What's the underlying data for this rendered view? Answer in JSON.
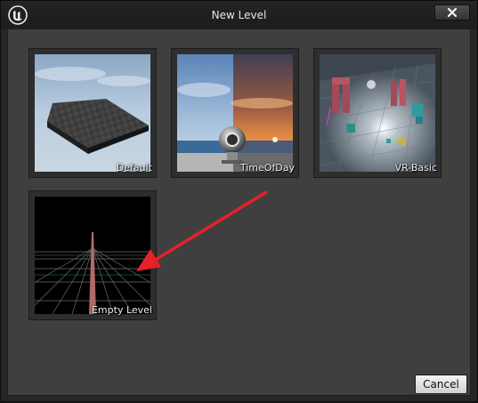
{
  "window": {
    "title": "New Level",
    "close_icon": "close-icon",
    "logo_icon": "unreal-engine-logo"
  },
  "templates": [
    {
      "label": "Default"
    },
    {
      "label": "TimeOfDay"
    },
    {
      "label": "VR-Basic"
    },
    {
      "label": "Empty Level"
    }
  ],
  "footer": {
    "cancel_label": "Cancel"
  },
  "annotation": {
    "arrow_color": "#e8202a",
    "icon": "red-arrow-annotation"
  }
}
